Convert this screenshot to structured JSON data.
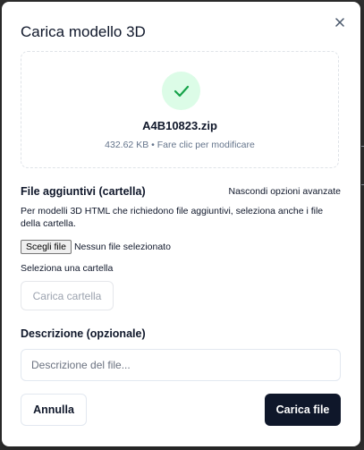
{
  "dialog": {
    "title": "Carica modello 3D",
    "close_icon": "close-icon"
  },
  "dropzone": {
    "status_icon": "check-icon",
    "file_name": "A4B10823.zip",
    "file_meta": "432.62 KB • Fare clic per modificare"
  },
  "extra_files": {
    "label": "File aggiuntivi (cartella)",
    "toggle_label": "Nascondi opzioni avanzate",
    "help_text": "Per modelli 3D HTML che richiedono file aggiuntivi, seleziona anche i file della cartella.",
    "choose_button_label": "Scegli file",
    "no_file_text": "Nessun file selezionato",
    "folder_prompt": "Seleziona una cartella",
    "folder_button_label": "Carica cartella"
  },
  "description": {
    "label": "Descrizione (opzionale)",
    "placeholder": "Descrizione del file...",
    "value": ""
  },
  "actions": {
    "cancel_label": "Annulla",
    "submit_label": "Carica file"
  },
  "colors": {
    "primary": "#0f172a",
    "success_bg": "#dcfce7",
    "success_icon": "#16a34a",
    "muted_text": "#64748b"
  }
}
